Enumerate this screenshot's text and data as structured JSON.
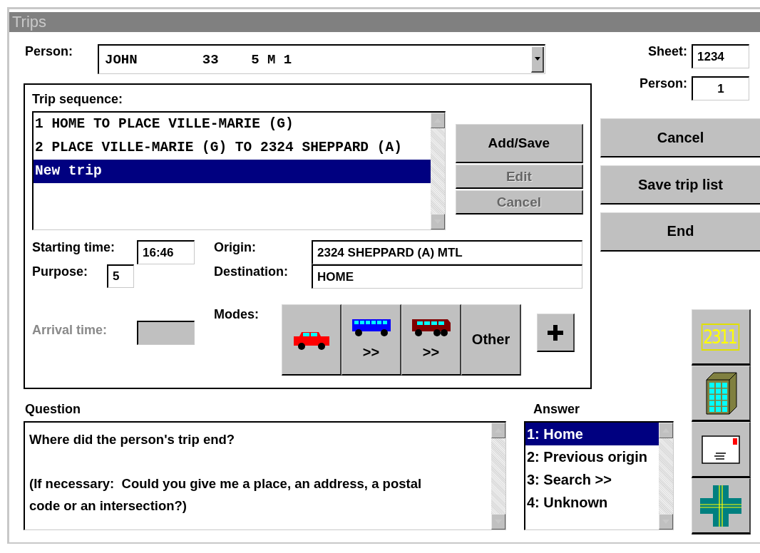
{
  "window": {
    "title": "Trips"
  },
  "person": {
    "label": "Person:",
    "value": "JOHN        33    5 M 1"
  },
  "sheet": {
    "label": "Sheet:",
    "value": "1234"
  },
  "person_number": {
    "label": "Person:",
    "value": "1"
  },
  "side_buttons": [
    {
      "label": "Cancel"
    },
    {
      "label": "Save trip list"
    },
    {
      "label": "End"
    }
  ],
  "trip_sequence": {
    "label": "Trip sequence:",
    "items": [
      {
        "text": "1 HOME TO PLACE VILLE-MARIE (G)",
        "selected": false
      },
      {
        "text": "2 PLACE VILLE-MARIE (G) TO 2324 SHEPPARD (A)",
        "selected": false
      },
      {
        "text": "New trip",
        "selected": true
      }
    ]
  },
  "trip_buttons": [
    {
      "label": "Add/Save",
      "disabled": false
    },
    {
      "label": "Edit",
      "disabled": true
    },
    {
      "label": "Cancel",
      "disabled": true
    }
  ],
  "starting_time": {
    "label": "Starting time:",
    "value": "16:46"
  },
  "purpose": {
    "label": "Purpose:",
    "value": "5"
  },
  "arrival_time": {
    "label": "Arrival time:",
    "disabled": true
  },
  "origin": {
    "label": "Origin:",
    "value": "2324 SHEPPARD (A) MTL"
  },
  "destination": {
    "label": "Destination:",
    "value": "HOME"
  },
  "modes": {
    "label": "Modes:",
    "buttons": [
      {
        "kind": "car"
      },
      {
        "kind": "bus",
        "label": ">>"
      },
      {
        "kind": "coach",
        "label": ">>"
      },
      {
        "kind": "text",
        "label": "Other"
      }
    ]
  },
  "question": {
    "label": "Question",
    "paragraphs": [
      "Where did the person's trip end?",
      "(If necessary:  Could you give me a place, an address, a postal code or an intersection?)"
    ]
  },
  "answer": {
    "label": "Answer",
    "items": [
      {
        "text": "1: Home",
        "selected": true
      },
      {
        "text": "2: Previous origin",
        "selected": false
      },
      {
        "text": "3: Search >>",
        "selected": false
      },
      {
        "text": "4: Unknown",
        "selected": false
      }
    ]
  },
  "tools": [
    {
      "kind": "counter",
      "label": "2311"
    },
    {
      "kind": "building"
    },
    {
      "kind": "envelope"
    },
    {
      "kind": "intersection"
    }
  ]
}
